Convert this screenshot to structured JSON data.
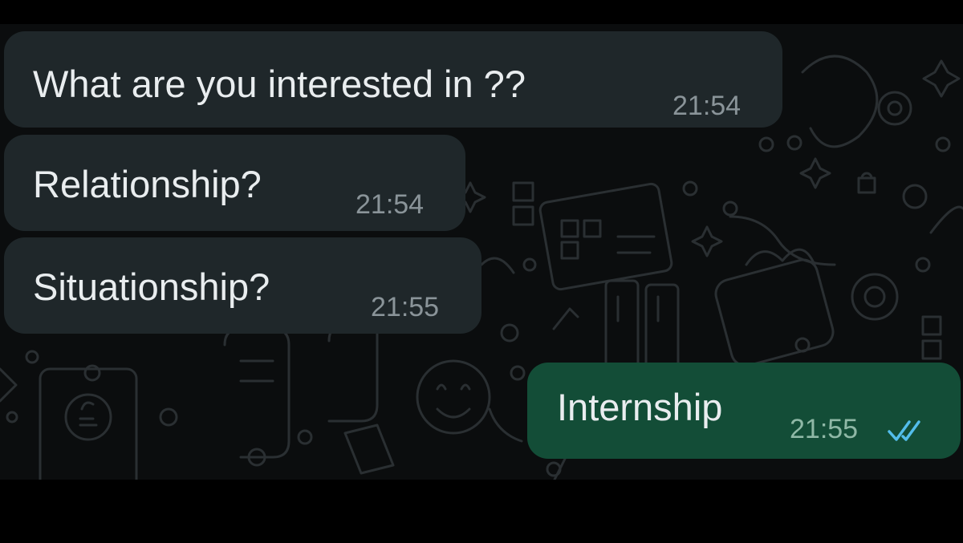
{
  "chat": {
    "messages": [
      {
        "direction": "incoming",
        "text": "What are you interested in ??",
        "time": "21:54"
      },
      {
        "direction": "incoming",
        "text": "Relationship?",
        "time": "21:54"
      },
      {
        "direction": "incoming",
        "text": "Situationship?",
        "time": "21:55"
      },
      {
        "direction": "outgoing",
        "text": "Internship",
        "time": "21:55",
        "status_icon": "double-check-read-icon"
      }
    ]
  },
  "colors": {
    "incoming_bubble": "#1f272a",
    "outgoing_bubble": "#134d37",
    "read_ticks": "#53bdeb",
    "wallpaper": "#0b0d0e"
  }
}
